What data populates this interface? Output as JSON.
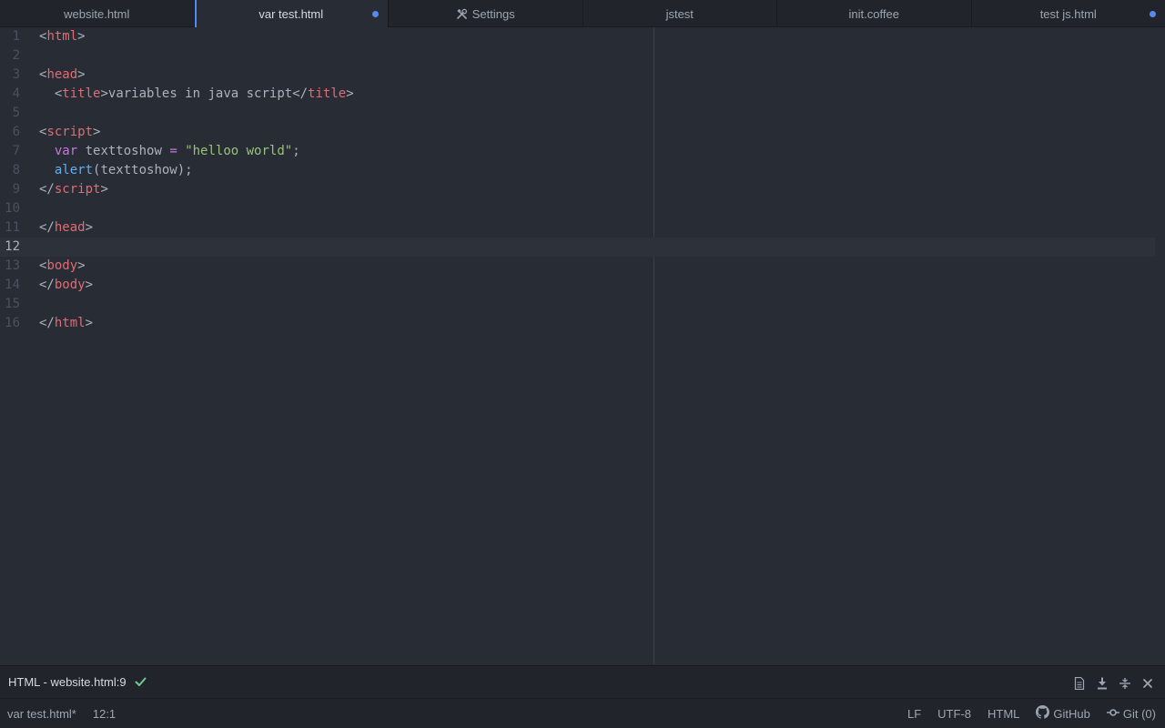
{
  "tabs": [
    {
      "label": "website.html",
      "active": false,
      "modified": false,
      "icon": ""
    },
    {
      "label": "var test.html",
      "active": true,
      "modified": true,
      "icon": ""
    },
    {
      "label": "Settings",
      "active": false,
      "modified": false,
      "icon": "tools-icon"
    },
    {
      "label": "jstest",
      "active": false,
      "modified": false,
      "icon": ""
    },
    {
      "label": "init.coffee",
      "active": false,
      "modified": false,
      "icon": ""
    },
    {
      "label": "test js.html",
      "active": false,
      "modified": true,
      "icon": ""
    }
  ],
  "editor": {
    "cursor_line": 12,
    "lines": [
      {
        "n": "1",
        "tokens": [
          [
            "p",
            "<"
          ],
          [
            "tag",
            "html"
          ],
          [
            "p",
            ">"
          ]
        ]
      },
      {
        "n": "2",
        "tokens": []
      },
      {
        "n": "3",
        "tokens": [
          [
            "p",
            "<"
          ],
          [
            "tag",
            "head"
          ],
          [
            "p",
            ">"
          ]
        ]
      },
      {
        "n": "4",
        "tokens": [
          [
            "text",
            "  "
          ],
          [
            "p",
            "<"
          ],
          [
            "tag",
            "title"
          ],
          [
            "p",
            ">"
          ],
          [
            "text",
            "variables in java script"
          ],
          [
            "p",
            "</"
          ],
          [
            "tag",
            "title"
          ],
          [
            "p",
            ">"
          ]
        ]
      },
      {
        "n": "5",
        "tokens": []
      },
      {
        "n": "6",
        "tokens": [
          [
            "p",
            "<"
          ],
          [
            "tag",
            "script"
          ],
          [
            "p",
            ">"
          ]
        ]
      },
      {
        "n": "7",
        "tokens": [
          [
            "text",
            "  "
          ],
          [
            "kw",
            "var"
          ],
          [
            "text",
            " texttoshow "
          ],
          [
            "op",
            "="
          ],
          [
            "text",
            " "
          ],
          [
            "str",
            "\"helloo world\""
          ],
          [
            "text",
            ";"
          ]
        ]
      },
      {
        "n": "8",
        "tokens": [
          [
            "text",
            "  "
          ],
          [
            "fn",
            "alert"
          ],
          [
            "text",
            "(texttoshow);"
          ]
        ]
      },
      {
        "n": "9",
        "tokens": [
          [
            "p",
            "</"
          ],
          [
            "tag",
            "script"
          ],
          [
            "p",
            ">"
          ]
        ]
      },
      {
        "n": "10",
        "tokens": []
      },
      {
        "n": "11",
        "tokens": [
          [
            "p",
            "</"
          ],
          [
            "tag",
            "head"
          ],
          [
            "p",
            ">"
          ]
        ]
      },
      {
        "n": "12",
        "tokens": []
      },
      {
        "n": "13",
        "tokens": [
          [
            "p",
            "<"
          ],
          [
            "tag",
            "body"
          ],
          [
            "p",
            ">"
          ]
        ]
      },
      {
        "n": "14",
        "tokens": [
          [
            "p",
            "</"
          ],
          [
            "tag",
            "body"
          ],
          [
            "p",
            ">"
          ]
        ]
      },
      {
        "n": "15",
        "tokens": []
      },
      {
        "n": "16",
        "tokens": [
          [
            "p",
            "</"
          ],
          [
            "tag",
            "html"
          ],
          [
            "p",
            ">"
          ]
        ]
      }
    ]
  },
  "linter": {
    "label": "HTML - website.html:9",
    "status_icon": "check-icon",
    "actions": [
      "file-icon",
      "download-icon",
      "collapse-icon",
      "close-icon"
    ]
  },
  "status": {
    "file": "var test.html*",
    "cursor": "12:1",
    "line_ending": "LF",
    "encoding": "UTF-8",
    "grammar": "HTML",
    "github": "GitHub",
    "git": "Git (0)"
  },
  "colors": {
    "accent": "#568af2",
    "check": "#73c990",
    "tag": "#e06c75",
    "keyword": "#c678dd",
    "string": "#98c379",
    "function": "#61afef"
  }
}
